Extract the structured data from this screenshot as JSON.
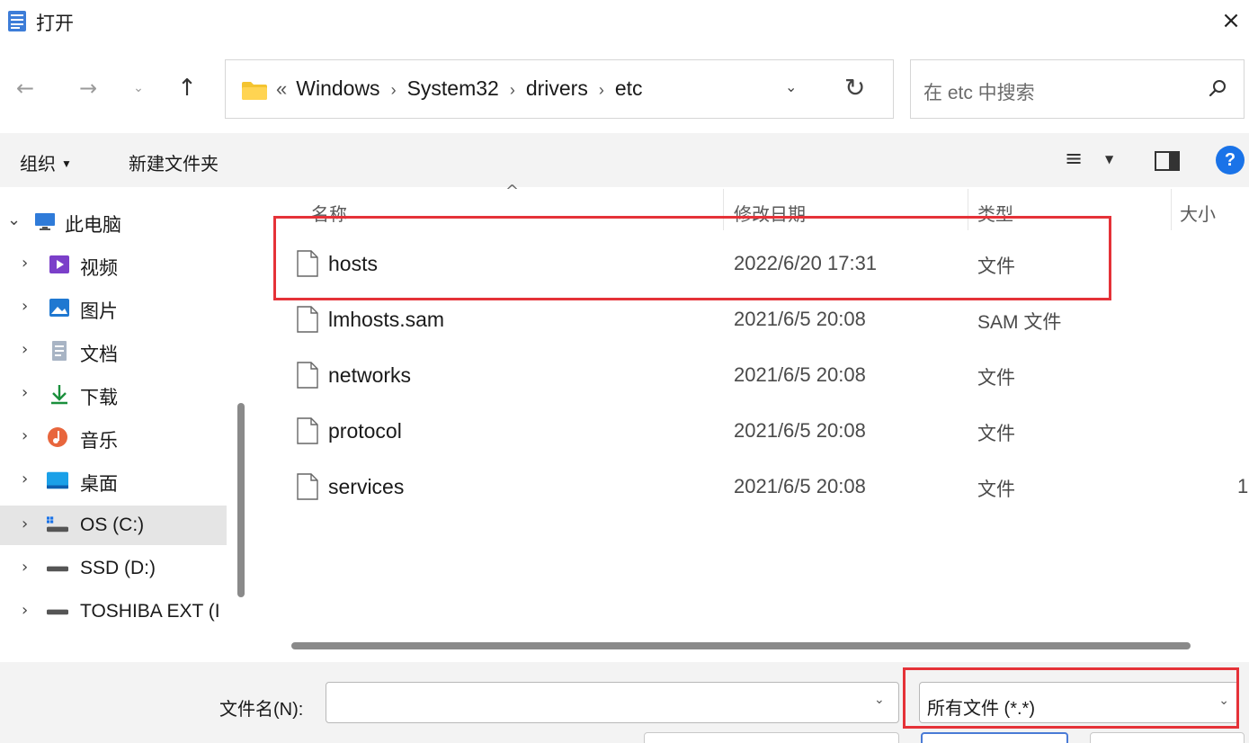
{
  "window": {
    "title": "打开",
    "close_label": "×",
    "app_icon": "notepad-icon"
  },
  "nav": {
    "back_glyph": "←",
    "forward_glyph": "→",
    "recent_glyph": "⌄",
    "up_glyph": "↑"
  },
  "address": {
    "overflow": "«",
    "crumbs": [
      "Windows",
      "System32",
      "drivers",
      "etc"
    ],
    "separator": "›",
    "dropdown_glyph": "⌄",
    "refresh_glyph": "↻"
  },
  "search": {
    "placeholder": "在 etc 中搜索"
  },
  "toolbar": {
    "organize_label": "组织",
    "organize_caret": "▼",
    "new_folder_label": "新建文件夹",
    "view_glyph": "≡",
    "view_caret": "▼",
    "help_label": "?"
  },
  "sidebar": {
    "items": [
      {
        "label": "此电脑",
        "icon": "monitor-icon",
        "expanded": true
      },
      {
        "label": "视频",
        "icon": "video-icon"
      },
      {
        "label": "图片",
        "icon": "pictures-icon"
      },
      {
        "label": "文档",
        "icon": "documents-icon"
      },
      {
        "label": "下载",
        "icon": "download-icon"
      },
      {
        "label": "音乐",
        "icon": "music-icon"
      },
      {
        "label": "桌面",
        "icon": "desktop-icon"
      },
      {
        "label": "OS (C:)",
        "icon": "system-drive-icon",
        "selected": true
      },
      {
        "label": "SSD (D:)",
        "icon": "drive-icon"
      },
      {
        "label": "TOSHIBA EXT (I",
        "icon": "drive-icon"
      }
    ]
  },
  "columns": {
    "name": "名称",
    "modified": "修改日期",
    "type": "类型",
    "size": "大小",
    "sort_glyph": "^"
  },
  "files": [
    {
      "name": "hosts",
      "modified": "2022/6/20 17:31",
      "type": "文件",
      "size": ""
    },
    {
      "name": "lmhosts.sam",
      "modified": "2021/6/5 20:08",
      "type": "SAM 文件",
      "size": ""
    },
    {
      "name": "networks",
      "modified": "2021/6/5 20:08",
      "type": "文件",
      "size": ""
    },
    {
      "name": "protocol",
      "modified": "2021/6/5 20:08",
      "type": "文件",
      "size": ""
    },
    {
      "name": "services",
      "modified": "2021/6/5 20:08",
      "type": "文件",
      "size": "1"
    }
  ],
  "bottom": {
    "filename_label": "文件名(N):",
    "filename_value": "",
    "filetype_value": "所有文件  (*.*)",
    "caret": "⌄"
  },
  "colors": {
    "annotation": "#e53238",
    "accent": "#1a73e8",
    "folder": "#f4c430"
  }
}
